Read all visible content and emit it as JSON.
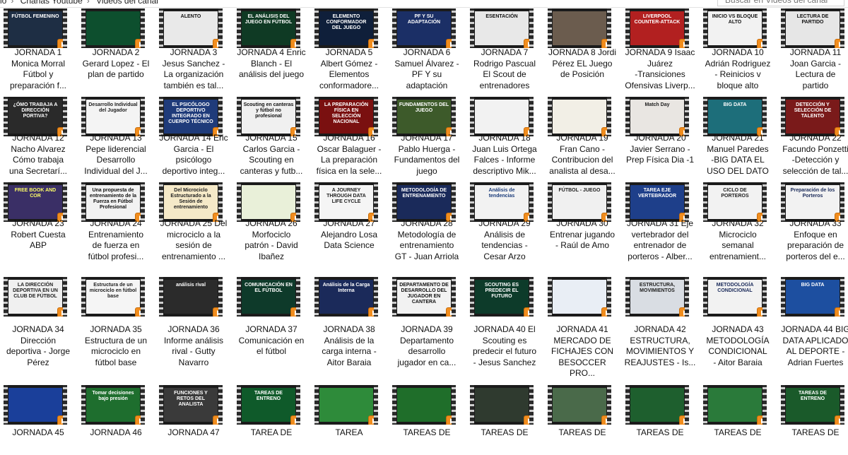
{
  "window": {
    "breadcrumb": [
      "lo",
      "Charlas Youtube",
      "Videos del canal"
    ],
    "search_placeholder": "Buscar en Videos del canal"
  },
  "thumbnail_text": {
    "t1": "FÚTBOL FEMENINO",
    "t2": "",
    "t3": "ALENTO",
    "t4": "EL ANÁLISIS DEL JUEGO EN FÚTBOL",
    "t5": "ELEMENTO CONFORMADOR DEL JUEGO",
    "t6": "PF Y SU ADAPTACIÓN",
    "t7": "ESENTACIÓN",
    "t8": "",
    "t9": "LIVERPOOL COUNTER-ATTACK",
    "t10": "INICIO VS BLOQUE ALTO",
    "t11": "LECTURA DE PARTIDO",
    "t12": "¿ÓMO TRABAJA A DIRECCIÓN PORTIVA?",
    "t13": "Desarrollo Individual del Jugador",
    "t14": "EL PSICÓLOGO DEPORTIVO INTEGRADO EN CUERPO TÉCNICO",
    "t15": "Scouting en canteras y fútbol no profesional",
    "t16": "LA PREPARACIÓN FÍSICA EN SELECCIÓN NACIONAL",
    "t17": "FUNDAMENTOS DEL JUEGO",
    "t18": "",
    "t19": "",
    "t20": "Match Day",
    "t21": "BIG DATA",
    "t22": "DETECCIÓN Y SELECCIÓN DE TALENTO",
    "t23": "FREE BOOK AND COR",
    "t24": "Una propuesta de entrenamiento de la Fuerza en Fútbol Profesional",
    "t25": "Del Microciclo Estructurado a la Sesión de entrenamiento",
    "t26": "",
    "t27": "A JOURNEY THROUGH DATA LIFE CYCLE",
    "t28": "METODOLOGÍA DE ENTRENAMIENTO",
    "t29": "Análisis de tendencias",
    "t30": "FÚTBOL - JUEGO",
    "t31": "TAREA EJE VERTEBRADOR",
    "t32": "CICLO DE PORTEROS",
    "t33": "Preparación de los Porteros",
    "t34": "LA DIRECCIÓN DEPORTIVA EN UN CLUB DE FÚTBOL",
    "t35": "Estructura de un microciclo en fútbol base",
    "t36": "análisis rival",
    "t37": "COMUNICACIÓN EN EL FÚTBOL",
    "t38": "Análisis de la Carga Interna",
    "t39": "DEPARTAMENTO DE DESARROLLO DEL JUGADOR EN CANTERA",
    "t40": "SCOUTING ES PREDECIR EL FUTURO",
    "t41": "",
    "t42": "ESTRUCTURA, MOVIMIENTOS",
    "t43": "METODOLOGÍA CONDICIONAL",
    "t44": "BIG DATA",
    "t45": "",
    "t46": "Tomar decisiones bajo presión",
    "t47": "FUNCIONES Y RETOS DEL ANALISTA",
    "t48": "TAREAS DE ENTRENO",
    "t49": "",
    "t50": "",
    "t51": "",
    "t52": "",
    "t53": "",
    "t54": "",
    "t55": "TAREAS DE ENTRENO"
  },
  "items": [
    {
      "label": "JORNADA 1\nMonica Morral\nFútbol y\npreparación f..."
    },
    {
      "label": "JORNADA 2\nGerard Lopez - El\nplan de partido"
    },
    {
      "label": "JORNADA 3\nJesus Sanchez -\nLa organización\ntambién es tal..."
    },
    {
      "label": "JORNADA 4 Enric\nBlanch - El\nanálisis del juego"
    },
    {
      "label": "JORNADA 5\nAlbert Gómez -\nElementos\nconformadore..."
    },
    {
      "label": "JORNADA 6\nSamuel Álvarez -\nPF Y su\nadaptación"
    },
    {
      "label": "JORNADA 7\nRodrigo Pascual\nEl Scout de\nentrenadores"
    },
    {
      "label": "JORNADA 8 Jordi\nPérez EL Juego\nde Posición"
    },
    {
      "label": "JORNADA 9 Isaac\nJuárez\n-Transiciones\nOfensivas Liverp..."
    },
    {
      "label": "JORNADA 10\nAdrián Rodriguez\n- Reinicios v\nbloque alto"
    },
    {
      "label": "JORNADA 11\nJoan Garcia -\nLectura de\npartido"
    },
    {
      "label": "JORNADA 12\nNacho Alvarez\nCómo trabaja\nuna Secretarí..."
    },
    {
      "label": "JORNADA 13\nPepe liderencial\nDesarrollo\nIndividual del J..."
    },
    {
      "label": "JORNADA 14 Eric\nGarcia - El\npsicólogo\ndeportivo integ..."
    },
    {
      "label": "JORNADA 15\nCarlos Garcia -\nScouting en\ncanteras y futb..."
    },
    {
      "label": "JORNADA 16\nOscar Balaguer -\nLa preparación\nfísica en la sele..."
    },
    {
      "label": "JORNADA 17\nPablo Huerga -\nFundamentos del\njuego"
    },
    {
      "label": "JORNADA 18\nJuan Luis Ortega\nFalces - Informe\ndescriptivo Mik..."
    },
    {
      "label": "JORNADA 19\nFran Cano -\nContribucion del\nanalista al desa..."
    },
    {
      "label": "JORNADA 20\nJavier Serrano -\nPrep Física Dia -1"
    },
    {
      "label": "JORNADA 21\nManuel Paredes\n-BIG DATA EL\nUSO DEL DATO"
    },
    {
      "label": "JORNADA 22\nFacundo Ponzetti\n-Detección y\nselección de tal..."
    },
    {
      "label": "JORNADA 23\nRobert Cuesta\nABP"
    },
    {
      "label": "JORNADA 24\nEntrenamiento\nde fuerza en\nfútbol profesi..."
    },
    {
      "label": "JORNADA 25 Del\nmicrociclo a la\nsesión de\nentrenamiento ..."
    },
    {
      "label": "JORNADA 26\nMorfociclo\npatrón - David\nIbañez"
    },
    {
      "label": "JORNADA 27\nAlejandro Losa\nData Science"
    },
    {
      "label": "JORNADA 28\nMetodología de\nentrenamiento\nGT - Juan Arriola"
    },
    {
      "label": "JORNADA 29\nAnálisis de\ntendencias -\nCesar Arzo"
    },
    {
      "label": "JORNADA 30\nEntrenar jugando\n- Raúl de Amo"
    },
    {
      "label": "JORNADA 31 Eje\nvertebrador del\nentrenador de\nporteros - Alber..."
    },
    {
      "label": "JORNADA 32\nMicrociclo\nsemanal\nentrenamient..."
    },
    {
      "label": "JORNADA 33\nEnfoque en\npreparación de\nporteros del e..."
    },
    {
      "label": "JORNADA 34\nDirección\ndeportiva - Jorge\nPérez"
    },
    {
      "label": "JORNADA 35\nEstructura de un\nmicrociclo en\nfútbol base"
    },
    {
      "label": "JORNADA 36\nInforme análisis\nrival - Gutty\nNavarro"
    },
    {
      "label": "JORNADA 37\nComunicación en\nel fútbol"
    },
    {
      "label": "JORNADA 38\nAnálisis de la\ncarga interna -\nAitor Baraia"
    },
    {
      "label": "JORNADA 39\nDepartamento\ndesarrollo\njugador en ca..."
    },
    {
      "label": "JORNADA 40 El\nScouting es\npredecir el futuro\n- Jesus Sanchez"
    },
    {
      "label": "JORNADA 41\nMERCADO DE\nFICHAJES CON\nBESOCCER PRO..."
    },
    {
      "label": "JORNADA 42\nESTRUCTURA,\nMOVIMIENTOS Y\nREAJUSTES - Is..."
    },
    {
      "label": "JORNADA 43\nMETODOLOGÍA\nCONDICIONAL\n- Aitor Baraia"
    },
    {
      "label": "JORNADA 44 BIG\nDATA APLICADO\nAL DEPORTE -\nAdrian Fuertes"
    },
    {
      "label": "JORNADA 45"
    },
    {
      "label": "JORNADA 46"
    },
    {
      "label": "JORNADA 47"
    },
    {
      "label": "TAREA DE"
    },
    {
      "label": "TAREA"
    },
    {
      "label": "TAREAS DE"
    },
    {
      "label": "TAREAS DE"
    },
    {
      "label": "TAREAS DE"
    },
    {
      "label": "TAREAS DE"
    },
    {
      "label": "TAREAS DE"
    },
    {
      "label": "TAREAS DE"
    }
  ],
  "colors": {
    "play_badge": "#f18d1e",
    "film_strip": "#1b1b1b"
  }
}
